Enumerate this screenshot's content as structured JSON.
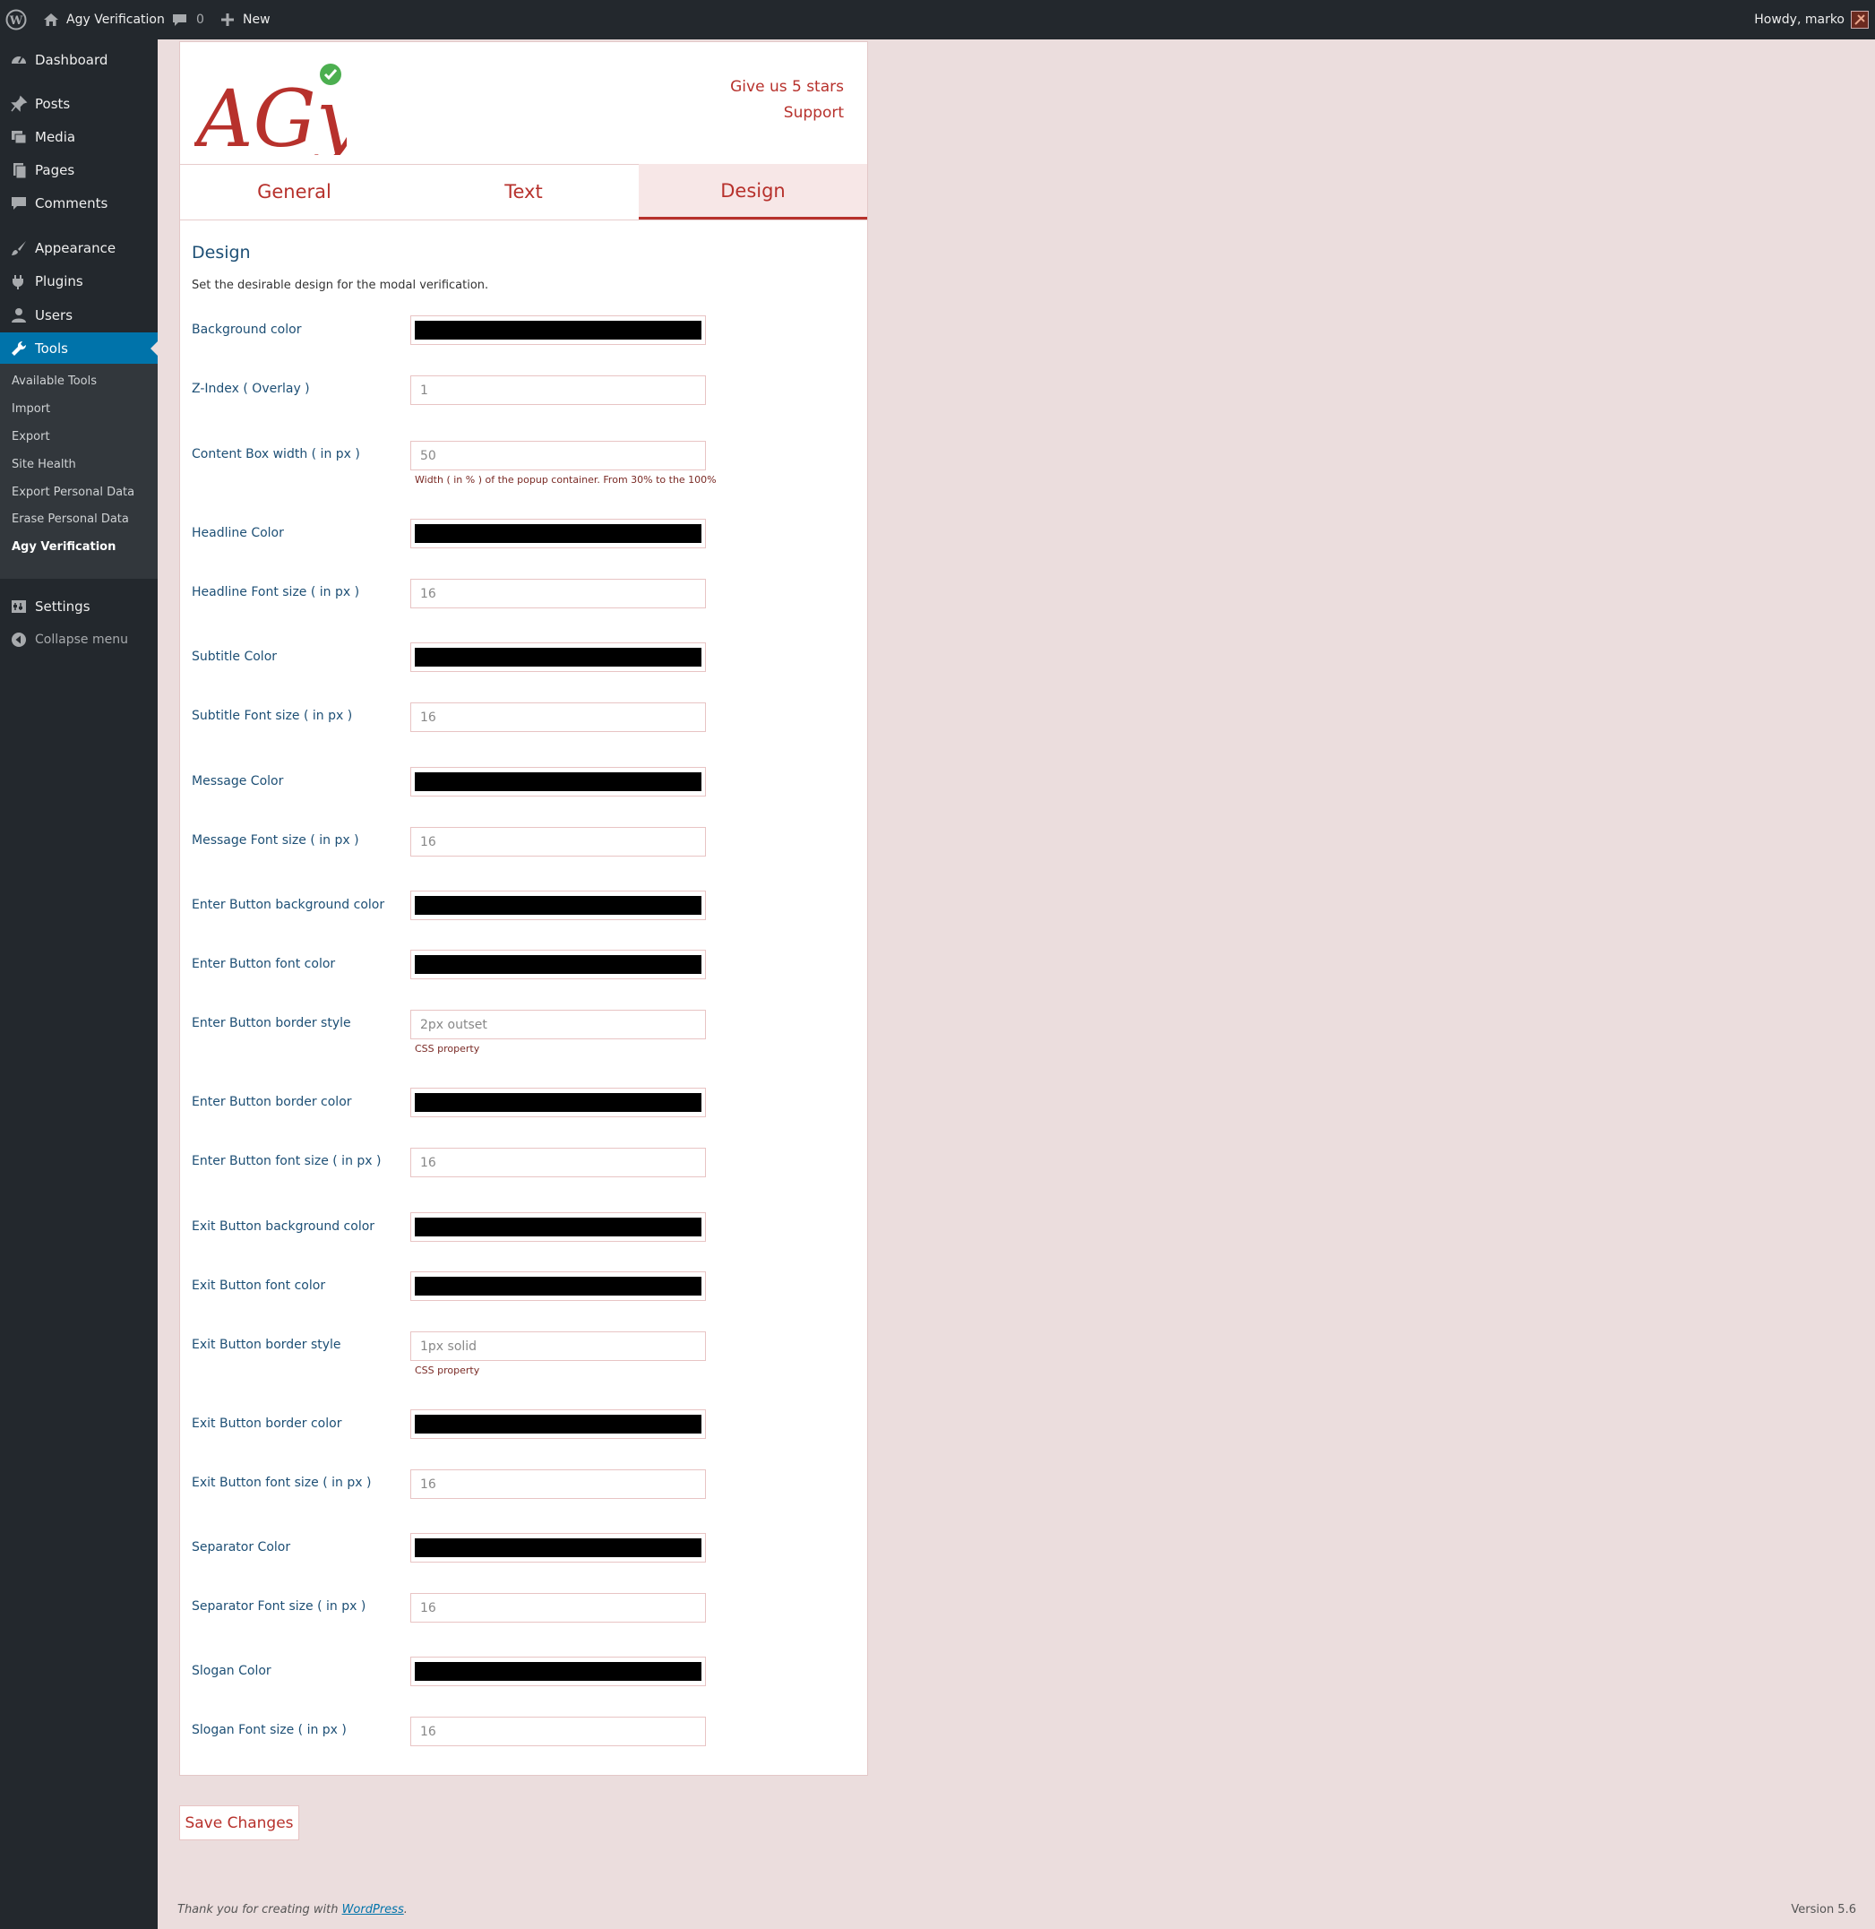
{
  "admin_bar": {
    "site_name": "Agy Verification",
    "comments_count": "0",
    "new_label": "New",
    "greeting": "Howdy, marko"
  },
  "sidebar": {
    "items": [
      {
        "label": "Dashboard",
        "icon": "dashboard-icon"
      },
      {
        "label": "Posts",
        "icon": "pin-icon"
      },
      {
        "label": "Media",
        "icon": "media-icon"
      },
      {
        "label": "Pages",
        "icon": "pages-icon"
      },
      {
        "label": "Comments",
        "icon": "comment-icon"
      },
      {
        "label": "Appearance",
        "icon": "brush-icon"
      },
      {
        "label": "Plugins",
        "icon": "plug-icon"
      },
      {
        "label": "Users",
        "icon": "user-icon"
      },
      {
        "label": "Tools",
        "icon": "wrench-icon"
      },
      {
        "label": "Settings",
        "icon": "settings-icon"
      },
      {
        "label": "Collapse menu",
        "icon": "collapse-icon"
      }
    ],
    "submenu": [
      "Available Tools",
      "Import",
      "Export",
      "Site Health",
      "Export Personal Data",
      "Erase Personal Data",
      "Agy Verification"
    ],
    "active_color": "#0073aa"
  },
  "plugin": {
    "logo_text": "AGy",
    "links": {
      "stars": "Give us 5 stars",
      "support": "Support"
    },
    "tabs": [
      "General",
      "Text",
      "Design"
    ],
    "active_tab": "Design",
    "accent_color": "#b7312c"
  },
  "design": {
    "title": "Design",
    "description": "Set the desirable design for the modal verification.",
    "fields": [
      {
        "label": "Background color",
        "type": "color",
        "value": "#000000"
      },
      {
        "label": "Z-Index ( Overlay )",
        "type": "text",
        "value": "1"
      },
      {
        "label": "Content Box width ( in px )",
        "type": "text",
        "value": "50",
        "hint": "Width ( in % ) of the popup container. From 30% to the 100%"
      },
      {
        "label": "Headline Color",
        "type": "color",
        "value": "#000000"
      },
      {
        "label": "Headline Font size ( in px )",
        "type": "text",
        "value": "16"
      },
      {
        "label": "Subtitle Color",
        "type": "color",
        "value": "#000000"
      },
      {
        "label": "Subtitle Font size ( in px )",
        "type": "text",
        "value": "16"
      },
      {
        "label": "Message Color",
        "type": "color",
        "value": "#000000"
      },
      {
        "label": "Message Font size ( in px )",
        "type": "text",
        "value": "16"
      },
      {
        "label": "Enter Button background color",
        "type": "color",
        "value": "#000000"
      },
      {
        "label": "Enter Button font color",
        "type": "color",
        "value": "#000000"
      },
      {
        "label": "Enter Button border style",
        "type": "text",
        "value": "2px outset",
        "hint": "CSS property"
      },
      {
        "label": "Enter Button border color",
        "type": "color",
        "value": "#000000"
      },
      {
        "label": "Enter Button font size ( in px )",
        "type": "text",
        "value": "16"
      },
      {
        "label": "Exit Button background color",
        "type": "color",
        "value": "#000000"
      },
      {
        "label": "Exit Button font color",
        "type": "color",
        "value": "#000000"
      },
      {
        "label": "Exit Button border style",
        "type": "text",
        "value": "1px solid",
        "hint": "CSS property"
      },
      {
        "label": "Exit Button border color",
        "type": "color",
        "value": "#000000"
      },
      {
        "label": "Exit Button font size ( in px )",
        "type": "text",
        "value": "16"
      },
      {
        "label": "Separator Color",
        "type": "color",
        "value": "#000000"
      },
      {
        "label": "Separator Font size ( in px )",
        "type": "text",
        "value": "16"
      },
      {
        "label": "Slogan Color",
        "type": "color",
        "value": "#000000"
      },
      {
        "label": "Slogan Font size ( in px )",
        "type": "text",
        "value": "16"
      }
    ]
  },
  "save_label": "Save Changes",
  "footer": {
    "thanks_prefix": "Thank you for creating with ",
    "wp_link": "WordPress",
    "thanks_suffix": ".",
    "version": "Version 5.6"
  }
}
